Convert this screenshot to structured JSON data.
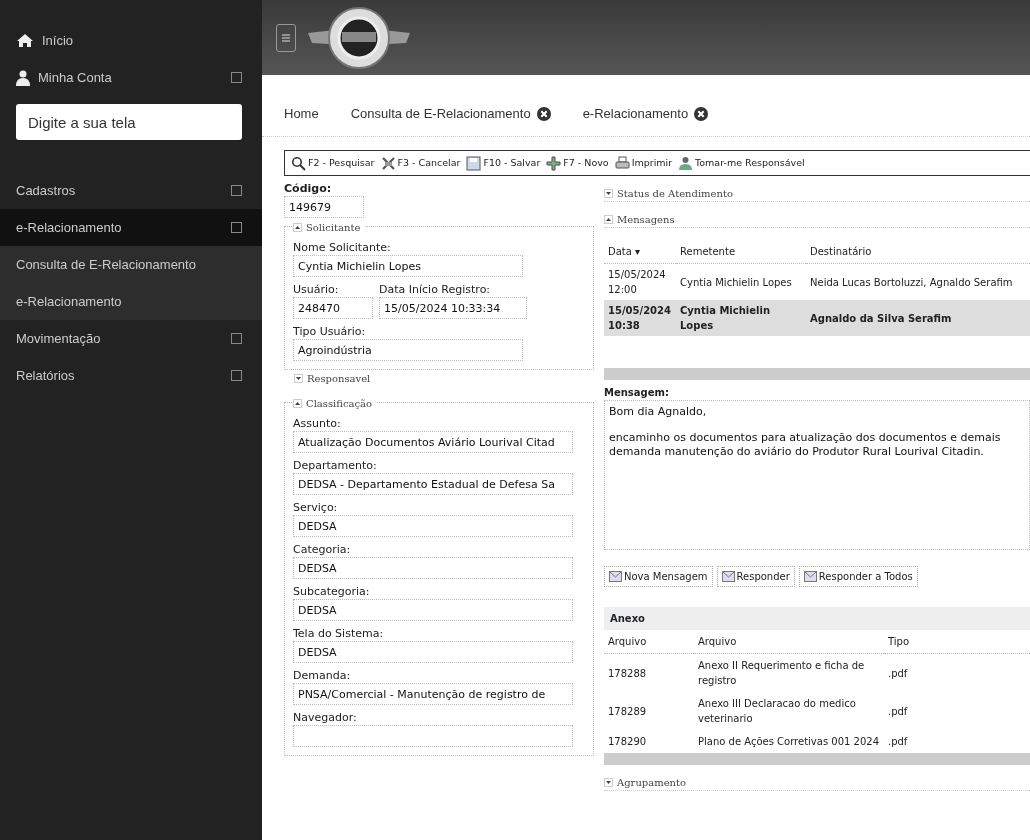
{
  "sidebar": {
    "items": [
      {
        "label": "Início",
        "kind": "link",
        "selected": false
      },
      {
        "label": "Minha Conta",
        "kind": "group",
        "selected": false
      },
      {
        "kind": "search",
        "placeholder": "Digite a sua tela"
      },
      {
        "label": "Cadastros",
        "kind": "group",
        "selected": false
      },
      {
        "label": "e-Relacionamento",
        "kind": "group",
        "selected": true,
        "children": [
          {
            "label": "Consulta de E-Relacionamento"
          },
          {
            "label": "e-Relacionamento"
          }
        ]
      },
      {
        "label": "Movimentação",
        "kind": "group",
        "selected": false
      },
      {
        "label": "Relatórios",
        "kind": "group",
        "selected": false
      }
    ]
  },
  "tabs": [
    {
      "label": "Home",
      "closable": false
    },
    {
      "label": "Consulta de E-Relacionamento",
      "closable": true
    },
    {
      "label": "e-Relacionamento",
      "closable": true
    }
  ],
  "toolbar": [
    "F2 - Pesquisar",
    "F3 - Cancelar",
    "F10 - Salvar",
    "F7 - Novo",
    "Imprimir",
    "Tomar-me Responsável"
  ],
  "codigo": {
    "label": "Código:",
    "value": "149679"
  },
  "left_sections": [
    {
      "title": "Solicitante",
      "expanded": true,
      "rows": [
        [
          {
            "label": "Nome Solicitante:",
            "value": "Cyntia Michielin Lopes"
          }
        ],
        [
          {
            "label": "Usuário:",
            "value": "248470"
          },
          {
            "label": "Data Início Registro:",
            "value": "15/05/2024 10:33:34"
          }
        ],
        [
          {
            "label": "Tipo Usuário:",
            "value": "Agroindústria"
          }
        ]
      ]
    },
    {
      "title": "Responsavel",
      "expanded": false
    },
    {
      "title": "Classificação",
      "expanded": true,
      "rows": [
        [
          {
            "label": "Assunto:",
            "value": "Atualização Documentos Aviário Lourival Citad"
          }
        ],
        [
          {
            "label": "Departamento:",
            "value": "DEDSA - Departamento Estadual de Defesa Sa"
          }
        ],
        [
          {
            "label": "Serviço:",
            "value": "DEDSA"
          }
        ],
        [
          {
            "label": "Categoria:",
            "value": "DEDSA"
          }
        ],
        [
          {
            "label": "Subcategoria:",
            "value": "DEDSA"
          }
        ],
        [
          {
            "label": "Tela do Sistema:",
            "value": "DEDSA"
          }
        ],
        [
          {
            "label": "Demanda:",
            "value": "PNSA/Comercial - Manutenção de registro de"
          }
        ],
        [
          {
            "label": "Navegador:"
          }
        ]
      ]
    }
  ],
  "status": {
    "title": "Status de Atendimento",
    "expanded": false
  },
  "mensagens": {
    "title": "Mensagens",
    "expanded": true,
    "columns": [
      "Data ▾",
      "Remetente",
      "Destinatário"
    ],
    "rows": [
      {
        "cells": [
          "15/05/2024 12:00",
          "Cyntia Michielin Lopes",
          "Neida Lucas Bortoluzzi, Agnaldo Serafim"
        ],
        "selected": false
      },
      {
        "cells": [
          "15/05/2024 10:38",
          "Cyntia Michielin Lopes",
          "Agnaldo da Silva Serafim"
        ],
        "selected": true
      }
    ],
    "message_label": "Mensagem:",
    "message": [
      "Bom dia Agnaldo,",
      "encaminho os documentos para atualização dos documentos e demais demanda manutenção do aviário do Produtor Rural Lourival Citadin."
    ],
    "buttons": [
      "Nova Mensagem",
      "Responder",
      "Responder a Todos"
    ]
  },
  "anexo": {
    "title": "Anexo",
    "columns": [
      "Arquivo",
      "Arquivo",
      "Tipo"
    ],
    "rows": [
      [
        "178288",
        "Anexo II Requerimento e ficha de registro",
        ".pdf"
      ],
      [
        "178289",
        "Anexo III Declaracao do medico veterinario",
        ".pdf"
      ],
      [
        "178290",
        "Plano de Ações Corretivas 001 2024",
        ".pdf"
      ]
    ]
  },
  "agrupamento": {
    "title": "Agrupamento",
    "expanded": false
  }
}
